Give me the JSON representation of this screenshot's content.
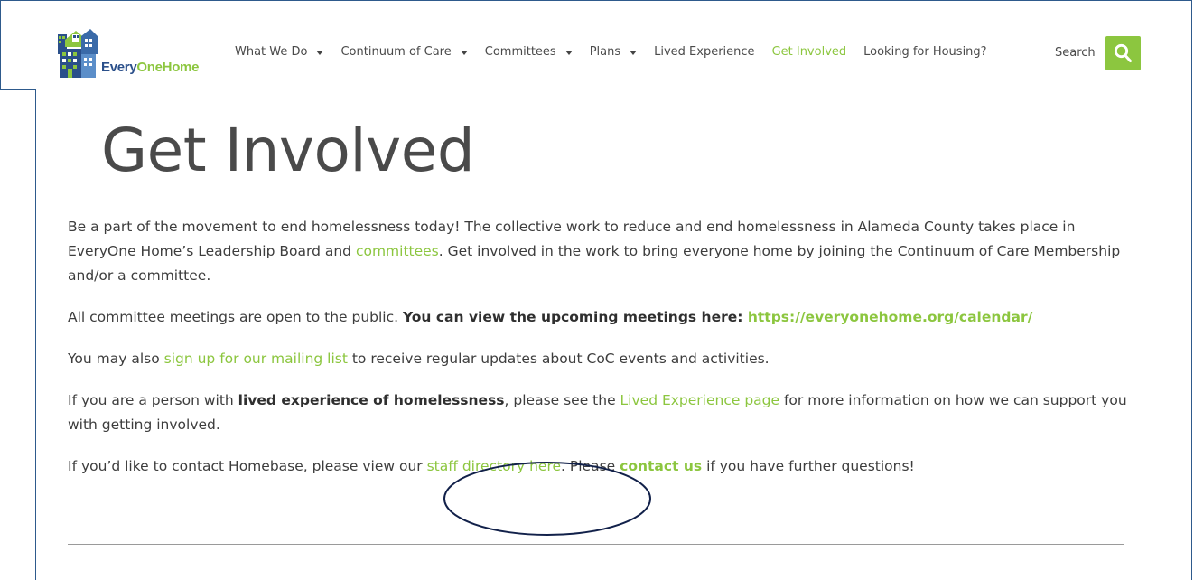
{
  "logo": {
    "text_every": "Every",
    "text_one": "One",
    "text_home": "Home"
  },
  "nav": {
    "items": [
      {
        "label": "What We Do",
        "dropdown": true
      },
      {
        "label": "Continuum of Care",
        "dropdown": true
      },
      {
        "label": "Committees",
        "dropdown": true
      },
      {
        "label": "Plans",
        "dropdown": true
      },
      {
        "label": "Lived Experience",
        "dropdown": false
      },
      {
        "label": "Get Involved",
        "dropdown": false,
        "active": true
      },
      {
        "label": "Looking for Housing?",
        "dropdown": false
      }
    ],
    "search_label": "Search"
  },
  "colors": {
    "accent": "#8cc63f",
    "brand_blue": "#2a4f8a",
    "annotation": "#12214a"
  },
  "page": {
    "title": "Get Involved",
    "p1": {
      "before": "Be a part of the movement to end homelessness today! The collective work to reduce and end homelessness in Alameda County takes place in EveryOne Home’s Leadership Board and ",
      "link": "committees",
      "after": ". Get involved in the work to bring everyone home by joining the Continuum of Care Membership and/or a committee."
    },
    "p2": {
      "before": "All committee meetings are open to the public. ",
      "bold": "You can view the upcoming meetings here: ",
      "link": "https://everyonehome.org/calendar/"
    },
    "p3": {
      "before": "You may also ",
      "link": "sign up for our mailing list",
      "after": " to receive regular updates about CoC events and activities."
    },
    "p4": {
      "before": "If you are a person with ",
      "bold": "lived experience of homelessness",
      "middle": ", please see the ",
      "link": "Lived Experience page",
      "after": " for more information on how we can support you with getting involved."
    },
    "p5": {
      "before": "If you’d like to contact Homebase, please view our ",
      "link": "staff directory here",
      "middle": ". Please ",
      "bold_link": "contact us",
      "after": " if you have further questions!"
    }
  }
}
